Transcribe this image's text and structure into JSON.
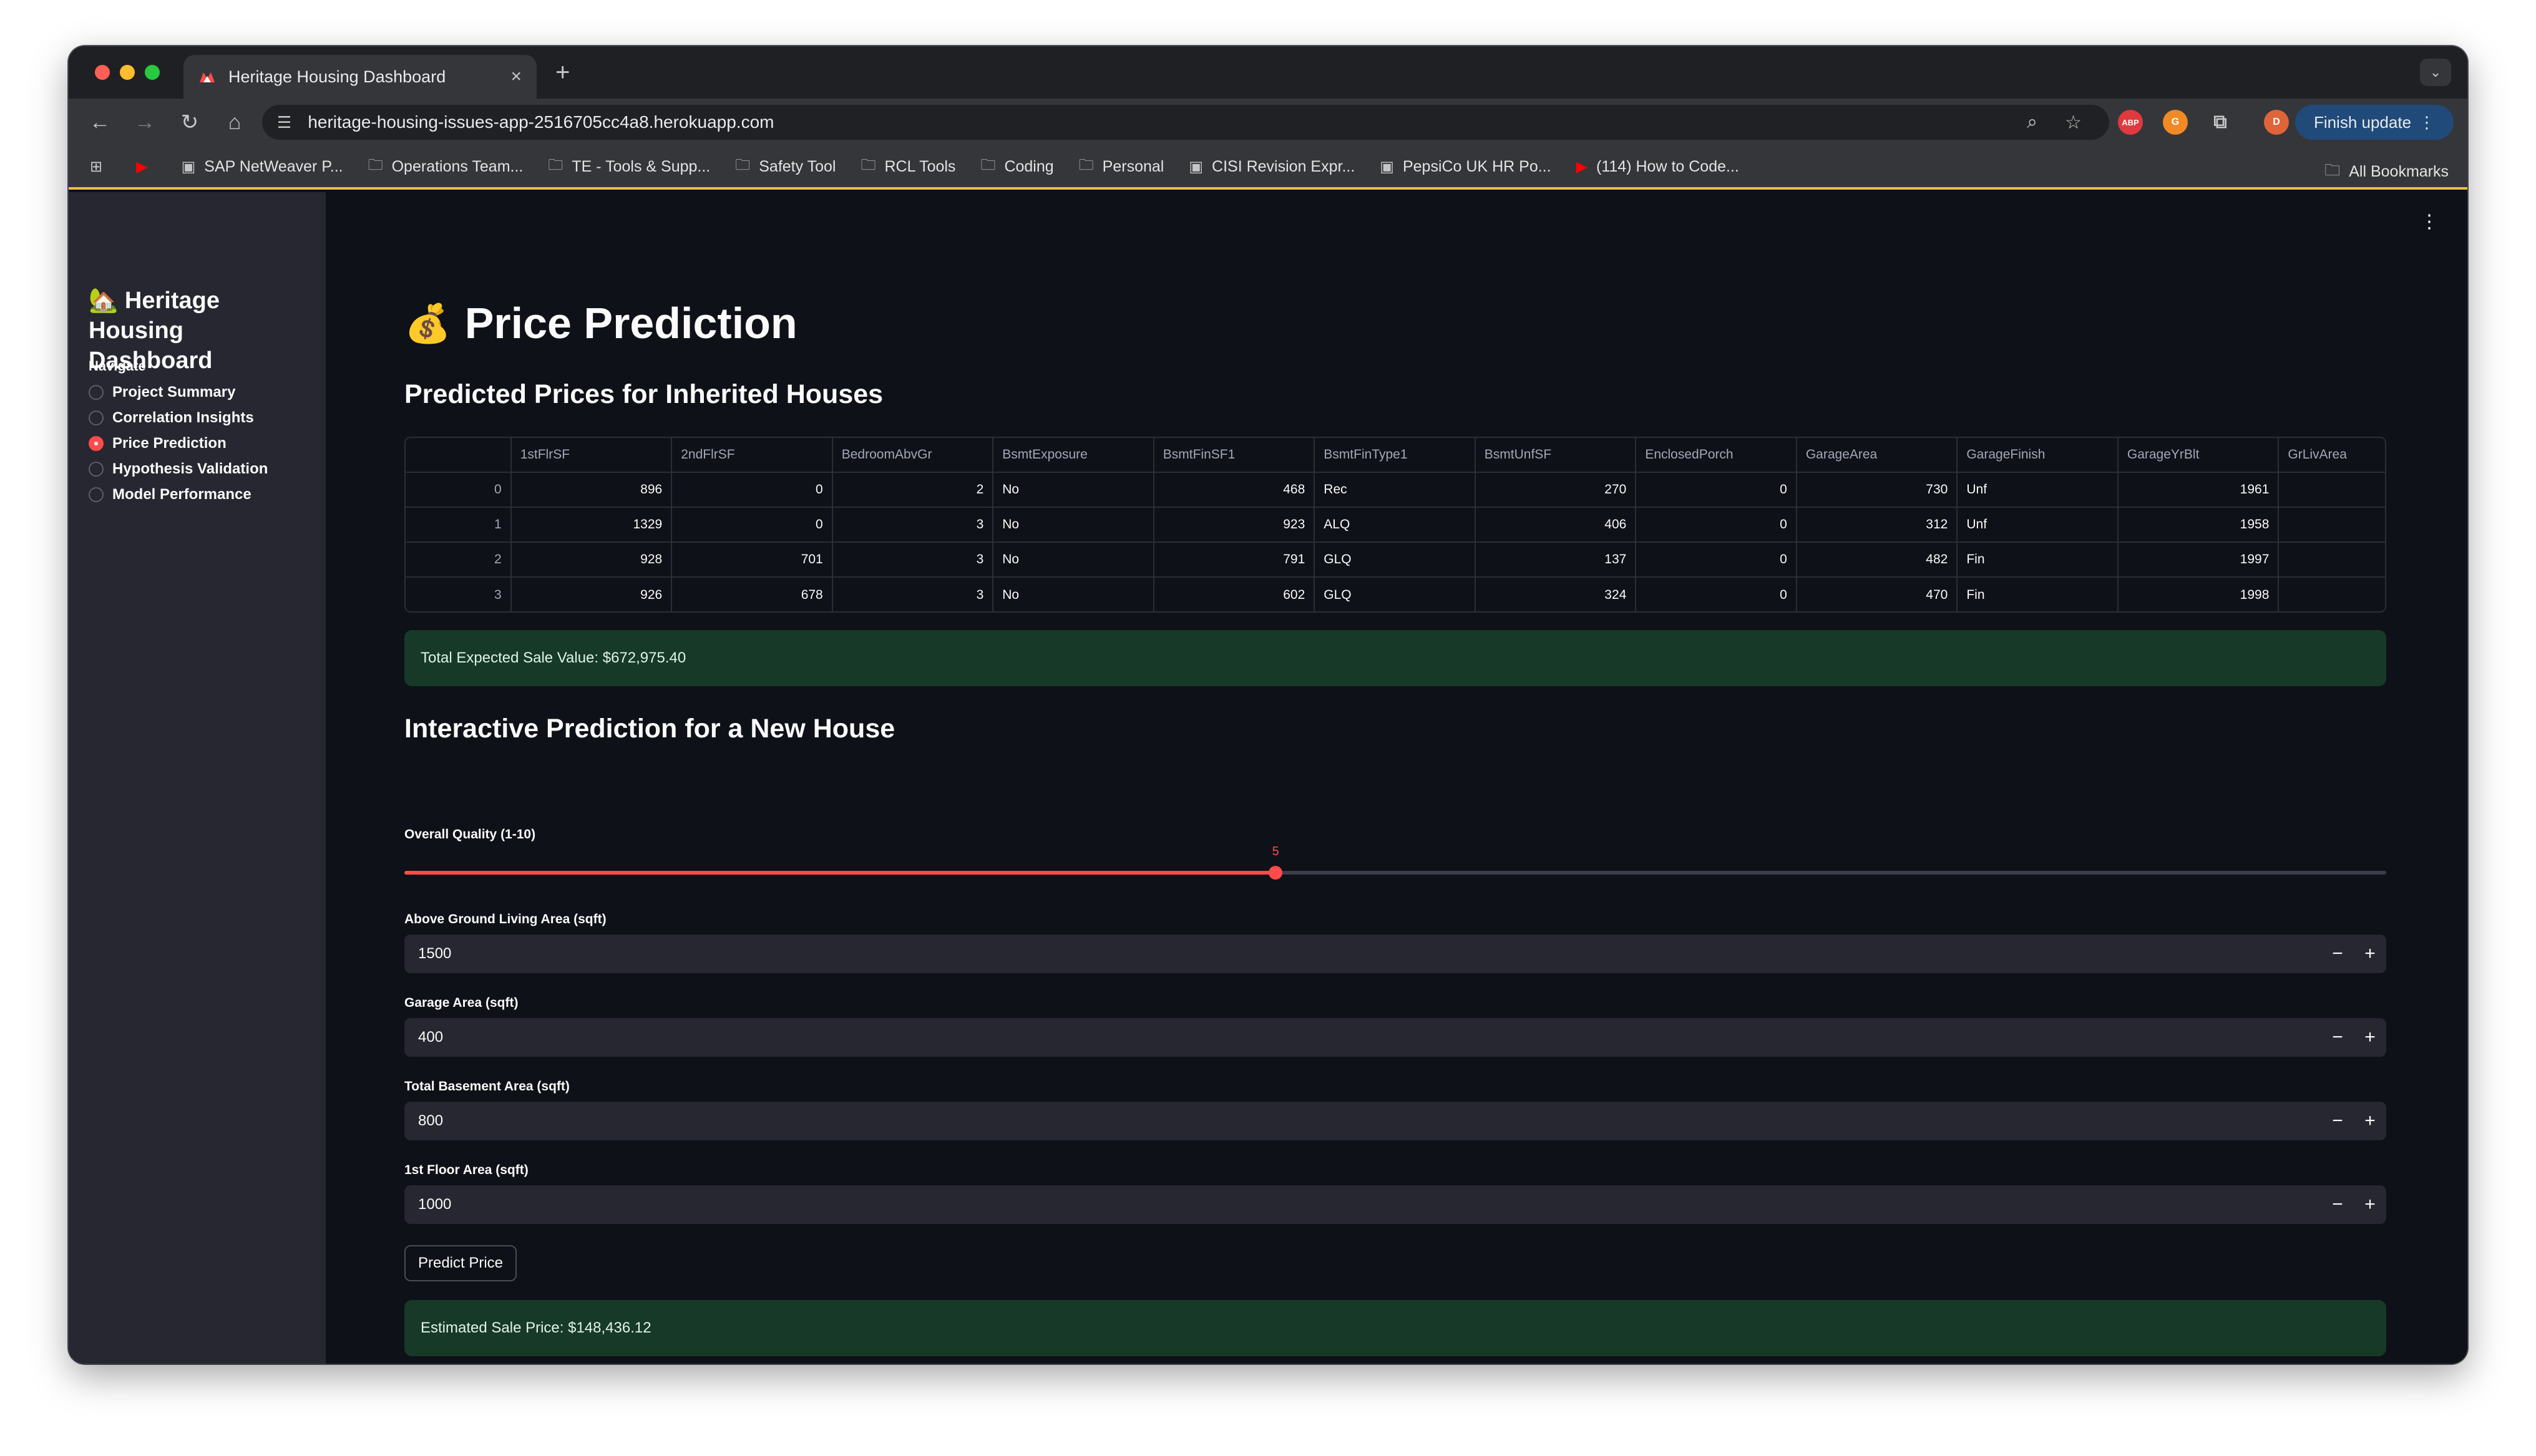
{
  "browser": {
    "tab_title": "Heritage Housing Dashboard",
    "url": "heritage-housing-issues-app-2516705cc4a8.herokuapp.com",
    "finish_update": "Finish update",
    "profile_initial": "D",
    "abp_label": "ABP",
    "bookmarks": [
      {
        "label": "SAP NetWeaver P...",
        "icon": "image-icon"
      },
      {
        "label": "Operations Team...",
        "icon": "folder-icon"
      },
      {
        "label": "TE - Tools & Supp...",
        "icon": "folder-icon"
      },
      {
        "label": "Safety Tool",
        "icon": "folder-icon"
      },
      {
        "label": "RCL Tools",
        "icon": "folder-icon"
      },
      {
        "label": "Coding",
        "icon": "folder-icon"
      },
      {
        "label": "Personal",
        "icon": "folder-icon"
      },
      {
        "label": "CISI Revision Expr...",
        "icon": "image-icon"
      },
      {
        "label": "PepsiCo UK HR Po...",
        "icon": "image-icon"
      },
      {
        "label": "(114) How to Code...",
        "icon": "youtube-icon"
      }
    ],
    "all_bookmarks": "All Bookmarks"
  },
  "sidebar": {
    "title": "Heritage Housing Dashboard",
    "nav_label": "Navigate",
    "items": [
      {
        "label": "Project Summary",
        "selected": false
      },
      {
        "label": "Correlation Insights",
        "selected": false
      },
      {
        "label": "Price Prediction",
        "selected": true
      },
      {
        "label": "Hypothesis Validation",
        "selected": false
      },
      {
        "label": "Model Performance",
        "selected": false
      }
    ]
  },
  "main": {
    "title": "Price Prediction",
    "predicted_heading": "Predicted Prices for Inherited Houses",
    "table": {
      "columns": [
        "1stFlrSF",
        "2ndFlrSF",
        "BedroomAbvGr",
        "BsmtExposure",
        "BsmtFinSF1",
        "BsmtFinType1",
        "BsmtUnfSF",
        "EnclosedPorch",
        "GarageArea",
        "GarageFinish",
        "GarageYrBlt",
        "GrLivArea"
      ],
      "rows": [
        [
          "0",
          "896",
          "0",
          "2",
          "No",
          "468",
          "Rec",
          "270",
          "0",
          "730",
          "Unf",
          "1961",
          ""
        ],
        [
          "1",
          "1329",
          "0",
          "3",
          "No",
          "923",
          "ALQ",
          "406",
          "0",
          "312",
          "Unf",
          "1958",
          ""
        ],
        [
          "2",
          "928",
          "701",
          "3",
          "No",
          "791",
          "GLQ",
          "137",
          "0",
          "482",
          "Fin",
          "1997",
          ""
        ],
        [
          "3",
          "926",
          "678",
          "3",
          "No",
          "602",
          "GLQ",
          "324",
          "0",
          "470",
          "Fin",
          "1998",
          ""
        ]
      ]
    },
    "total_expected": "Total Expected Sale Value: $672,975.40",
    "interactive_heading": "Interactive Prediction for a New House",
    "quality": {
      "label": "Overall Quality (1-10)",
      "value": 5,
      "min": 1,
      "max": 10,
      "display": "5"
    },
    "inputs": [
      {
        "label": "Above Ground Living Area (sqft)",
        "value": "1500"
      },
      {
        "label": "Garage Area (sqft)",
        "value": "400"
      },
      {
        "label": "Total Basement Area (sqft)",
        "value": "800"
      },
      {
        "label": "1st Floor Area (sqft)",
        "value": "1000"
      }
    ],
    "predict_button": "Predict Price",
    "estimated": "Estimated Sale Price: $148,436.12"
  },
  "colors": {
    "accent": "#ff4b4b",
    "app_bg": "#0e1117",
    "sidebar_bg": "#262730",
    "success_bg": "#173928"
  }
}
